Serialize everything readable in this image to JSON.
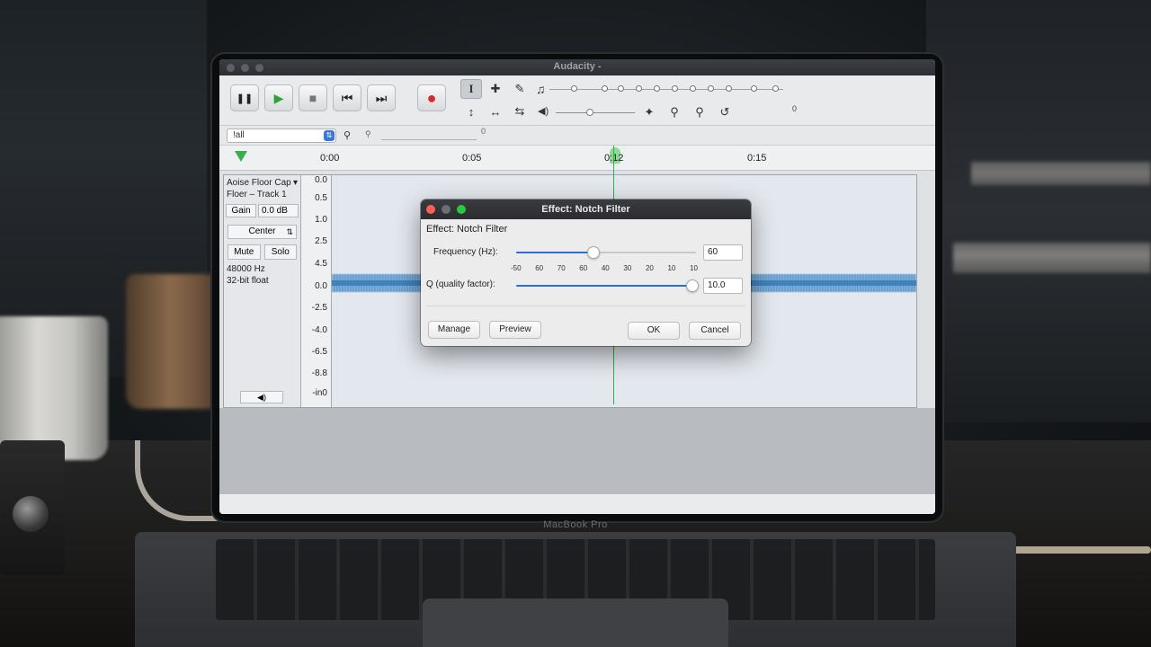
{
  "window": {
    "title": "Audacity -"
  },
  "laptop": {
    "label": "MacBook Pro"
  },
  "transport": {
    "pause_icon": "❚❚",
    "play_icon": "▶",
    "stop_icon": "■",
    "skip_start_icon": "⏮",
    "skip_end_icon": "⏭",
    "record_icon": "●"
  },
  "tools": {
    "selection_icon": "I",
    "multi_icon": "✚",
    "draw_icon": "✎",
    "envelope_icon": "↕",
    "zoom_icon": "↔",
    "timeshift_icon": "⇆"
  },
  "meters": {
    "playback_readout": "0",
    "zoom_readout": "0"
  },
  "selection_toolbar": {
    "select_value": "!all",
    "chevron": "⇅",
    "search_readout": "0"
  },
  "timeline": {
    "labels": [
      "0:00",
      "0:05",
      "0:12",
      "0:15"
    ]
  },
  "track": {
    "name_line1": "Aoise Floor Cap",
    "name_line2": "Floer – Track 1",
    "menu_arrow": "▾",
    "gain_label": "Gain",
    "gain_value": "0.0 dB",
    "pan_label": "Center",
    "pan_chevron": "⇅",
    "mute_label": "Mute",
    "solo_label": "Solo",
    "rate": "48000 Hz",
    "format": "32-bit float",
    "speaker_icon": "◀)"
  },
  "scale": {
    "labels": [
      "0.0",
      "0.5",
      "1.0",
      "2.5",
      "4.5",
      "0.0",
      "-2.5",
      "-4.0",
      "-6.5",
      "-8.8",
      "-in0"
    ]
  },
  "dialog": {
    "title": "Effect: Notch Filter",
    "header": "Effect: Notch Filter",
    "frequency_label": "Frequency (Hz):",
    "frequency_value": "60",
    "frequency_level": 0.43,
    "ticks": [
      "-50",
      "60",
      "70",
      "60",
      "40",
      "30",
      "20",
      "10",
      "10"
    ],
    "q_label": "Q (quality factor):",
    "q_value": "10.0",
    "q_level": 1.0,
    "buttons": {
      "manage": "Manage",
      "preview": "Preview",
      "ok": "OK",
      "cancel": "Cancel"
    },
    "colors": {
      "close": "#ff5f57",
      "minimize": "#6b6e72",
      "zoom": "#28c840",
      "accent": "#2d6fd1"
    }
  }
}
